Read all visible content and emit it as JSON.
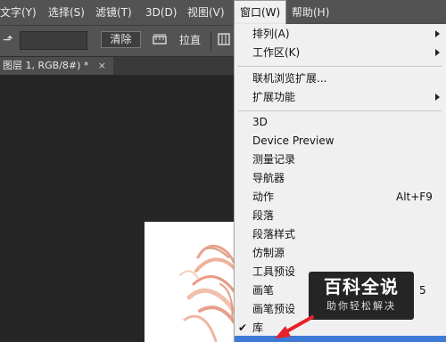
{
  "menubar": {
    "items": [
      {
        "label": "文字(Y)"
      },
      {
        "label": "选择(S)"
      },
      {
        "label": "滤镜(T)"
      },
      {
        "label": "3D(D)"
      },
      {
        "label": "视图(V)"
      },
      {
        "label": "窗口(W)"
      },
      {
        "label": "帮助(H)"
      }
    ]
  },
  "optionsbar": {
    "clear_label": "清除",
    "straighten_label": "拉直"
  },
  "document": {
    "tab_label": "图层 1, RGB/8#) *",
    "close_glyph": "×"
  },
  "window_menu": {
    "items": [
      {
        "label": "排列(A)",
        "submenu": true
      },
      {
        "label": "工作区(K)",
        "submenu": true
      },
      {
        "label": "联机浏览扩展..."
      },
      {
        "label": "扩展功能",
        "submenu": true
      },
      {
        "label": "3D"
      },
      {
        "label": "Device Preview"
      },
      {
        "label": "测量记录"
      },
      {
        "label": "导航器"
      },
      {
        "label": "动作",
        "shortcut": "Alt+F9"
      },
      {
        "label": "段落"
      },
      {
        "label": "段落样式"
      },
      {
        "label": "仿制源"
      },
      {
        "label": "工具预设"
      },
      {
        "label": "画笔",
        "shortcut": "5"
      },
      {
        "label": "画笔预设"
      },
      {
        "label": "库",
        "checked": true
      }
    ],
    "check_glyph": "✔"
  },
  "watermark": {
    "title": "百科全说",
    "subtitle": "助你轻松解决"
  },
  "colors": {
    "menubar_bg": "#535353",
    "menu_bg": "#f0f0f0",
    "highlight": "#3d7ad6",
    "arrow": "#e8202a"
  }
}
